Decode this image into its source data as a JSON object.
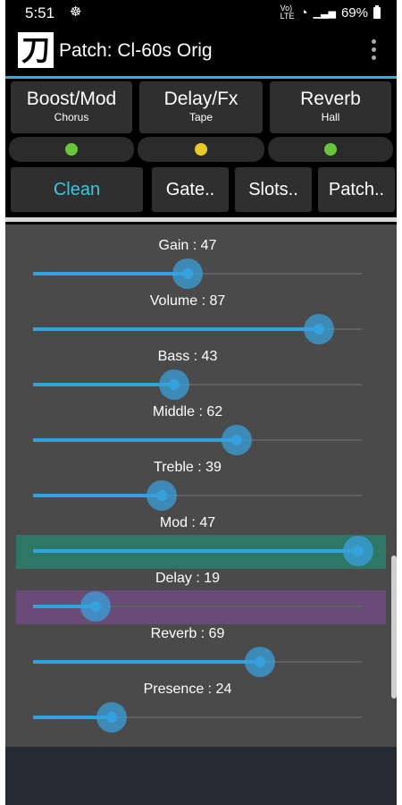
{
  "status_bar": {
    "time": "5:51",
    "notification_icon": "☸",
    "network_label_top": "Vo)",
    "network_label_bottom": "LTE",
    "wifi_icon": "◔",
    "signal_icon": "▁▃▅",
    "battery": "69%"
  },
  "app_bar": {
    "logo_glyph": "刀",
    "title": "Patch: Cl-60s Orig"
  },
  "effects": [
    {
      "name": "Boost/Mod",
      "sub": "Chorus",
      "led": "#6ac43c"
    },
    {
      "name": "Delay/Fx",
      "sub": "Tape",
      "led": "#e8c92a"
    },
    {
      "name": "Reverb",
      "sub": "Hall",
      "led": "#6ac43c"
    }
  ],
  "tabs": [
    {
      "label": "Clean"
    },
    {
      "label": "Gate.."
    },
    {
      "label": "Slots.."
    },
    {
      "label": "Patch.."
    }
  ],
  "sliders": [
    {
      "label": "Gain : 47",
      "value": 47,
      "highlight": null
    },
    {
      "label": "Volume : 87",
      "value": 87,
      "highlight": null
    },
    {
      "label": "Bass : 43",
      "value": 43,
      "highlight": null
    },
    {
      "label": "Middle : 62",
      "value": 62,
      "highlight": null
    },
    {
      "label": "Treble : 39",
      "value": 39,
      "highlight": null
    },
    {
      "label": "Mod : 47",
      "value": 99,
      "highlight": "#2e7767"
    },
    {
      "label": "Delay : 19",
      "value": 19,
      "highlight": "#6a4a77"
    },
    {
      "label": "Reverb : 69",
      "value": 69,
      "highlight": null
    },
    {
      "label": "Presence : 24",
      "value": 24,
      "highlight": null
    }
  ],
  "colors": {
    "accent": "#3ea8d8",
    "active_tab_text": "#3cc6e0",
    "slider_fill": "#2fa3dd"
  }
}
